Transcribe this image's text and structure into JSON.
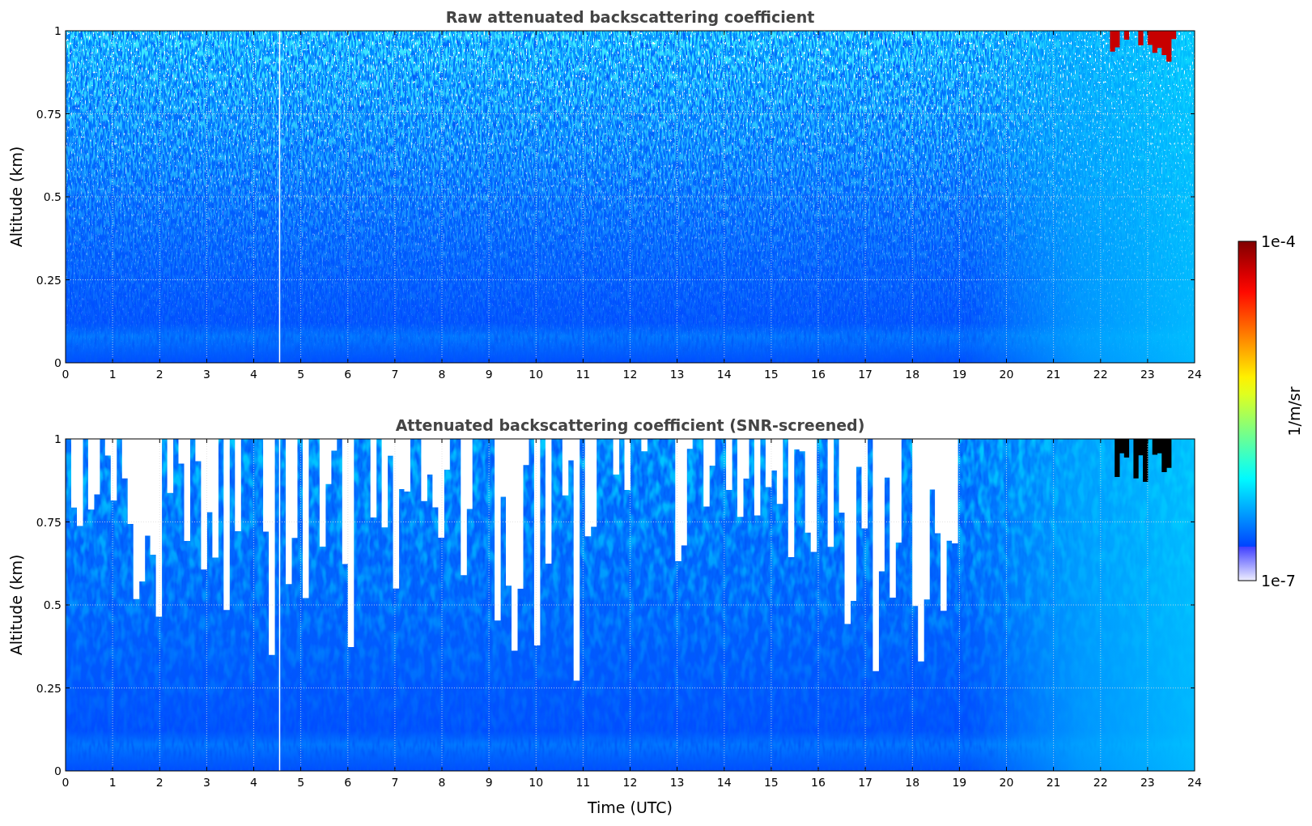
{
  "figure": {
    "panels": [
      {
        "kind": "raw",
        "title": "Raw attenuated backscattering coefficient",
        "ylabel": "Altitude (km)",
        "yticks": [
          "1",
          "0.75",
          "0.5",
          "0.25",
          "0"
        ],
        "xticks": [
          "0",
          "1",
          "2",
          "3",
          "4",
          "5",
          "6",
          "7",
          "8",
          "9",
          "10",
          "11",
          "12",
          "13",
          "14",
          "15",
          "16",
          "17",
          "18",
          "19",
          "20",
          "21",
          "22",
          "23",
          "24"
        ]
      },
      {
        "kind": "screened",
        "title": "Attenuated backscattering coefficient (SNR-screened)",
        "ylabel": "Altitude (km)",
        "yticks": [
          "1",
          "0.75",
          "0.5",
          "0.25",
          "0"
        ],
        "xticks": [
          "0",
          "1",
          "2",
          "3",
          "4",
          "5",
          "6",
          "7",
          "8",
          "9",
          "10",
          "11",
          "12",
          "13",
          "14",
          "15",
          "16",
          "17",
          "18",
          "19",
          "20",
          "21",
          "22",
          "23",
          "24"
        ]
      }
    ],
    "xlabel": "Time (UTC)",
    "colorbar": {
      "max_label": "1e-4",
      "min_label": "1e-7",
      "label": "1/m/sr"
    }
  }
}
